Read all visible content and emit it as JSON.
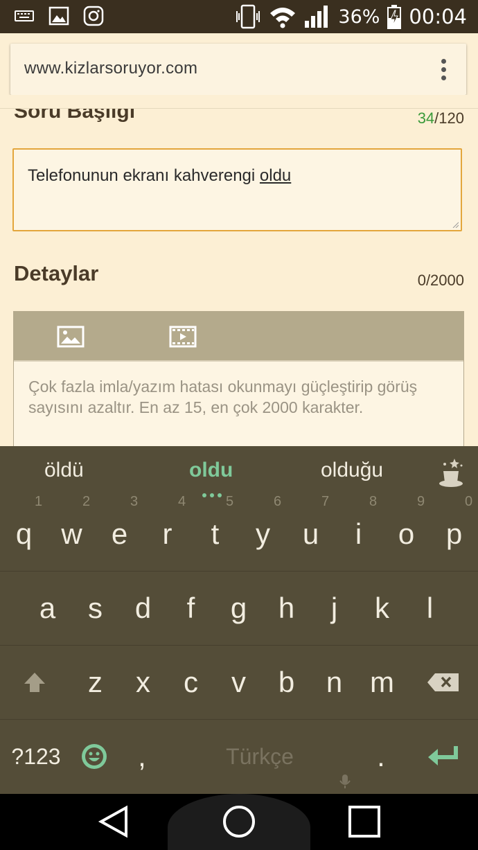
{
  "status_bar": {
    "battery": "36%",
    "time": "00:04",
    "icons": [
      "keyboard-icon",
      "image-icon",
      "instagram-icon",
      "vibrate-icon",
      "wifi-icon",
      "signal-icon",
      "battery-charging-icon"
    ]
  },
  "browser": {
    "url": "www.kizlarsoruyor.com",
    "menu_icon": "overflow-menu-icon"
  },
  "form": {
    "title_label": "Soru Başlıgı",
    "title_count_current": "34",
    "title_count_max": "/120",
    "title_value_prefix": "Telefonunun ekranı kahverengi ",
    "title_value_underlined": "oldu",
    "details_label": "Detaylar",
    "details_count": "0/2000",
    "details_placeholder": "Çok fazla imla/yazım hatası okunmayı güçleştirip görüş sayısını azaltır. En az 15, en çok 2000 karakter.",
    "accent_color": "#e3a63c"
  },
  "keyboard": {
    "suggestions": [
      "öldü",
      "oldu",
      "olduğu"
    ],
    "row1": [
      {
        "key": "q",
        "num": "1"
      },
      {
        "key": "w",
        "num": "2"
      },
      {
        "key": "e",
        "num": "3"
      },
      {
        "key": "r",
        "num": "4"
      },
      {
        "key": "t",
        "num": "5"
      },
      {
        "key": "y",
        "num": "6"
      },
      {
        "key": "u",
        "num": "7"
      },
      {
        "key": "i",
        "num": "8"
      },
      {
        "key": "o",
        "num": "9"
      },
      {
        "key": "p",
        "num": "0"
      }
    ],
    "row2": [
      "a",
      "s",
      "d",
      "f",
      "g",
      "h",
      "j",
      "k",
      "l"
    ],
    "row3": [
      "z",
      "x",
      "c",
      "v",
      "b",
      "n",
      "m"
    ],
    "symbols_key": "?123",
    "comma_key": ",",
    "space_label": "Türkçe",
    "period_key": ".",
    "suggestion_color": "#7fc99a"
  },
  "nav": {
    "buttons": [
      "back-icon",
      "home-icon",
      "recents-icon"
    ]
  }
}
